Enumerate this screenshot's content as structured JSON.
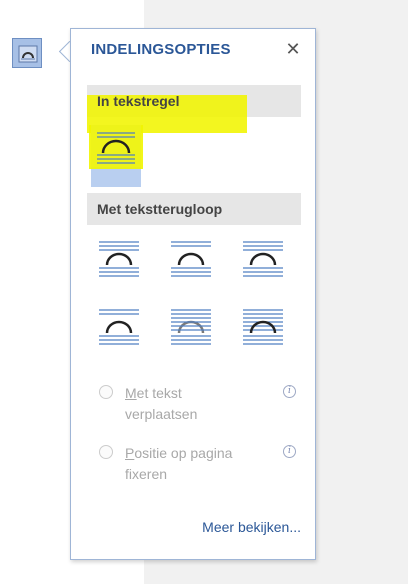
{
  "panel": {
    "title": "INDELINGSOPTIES",
    "close_glyph": "✕",
    "close_icon": "close-icon"
  },
  "sections": {
    "inline": {
      "label": "In tekstregel"
    },
    "wrap": {
      "label": "Met tekstterugloop"
    }
  },
  "options": {
    "inline": {
      "name": "in-line-with-text",
      "icon": "inline-layout-icon",
      "selected": true
    },
    "wrapping": [
      {
        "name": "square",
        "icon": "square-wrap-icon"
      },
      {
        "name": "tight",
        "icon": "tight-wrap-icon"
      },
      {
        "name": "through",
        "icon": "through-wrap-icon"
      },
      {
        "name": "top-and-bottom",
        "icon": "top-bottom-wrap-icon"
      },
      {
        "name": "behind-text",
        "icon": "behind-text-icon"
      },
      {
        "name": "in-front-of-text",
        "icon": "in-front-of-text-icon"
      }
    ]
  },
  "radios": {
    "move_with_text": {
      "accel": "M",
      "rest1": "et tekst",
      "line2": "verplaatsen",
      "info_icon": "info-icon"
    },
    "fix_position": {
      "accel": "P",
      "rest1": "ositie op pagina",
      "line2": "fixeren",
      "info_icon": "info-icon"
    }
  },
  "more_link": "Meer bekijken...",
  "colors": {
    "accent": "#2b5797",
    "highlight": "#f1f500",
    "selected_bg": "#cfe0f7",
    "section_bg": "#e6e6e6",
    "disabled_text": "#a8a8a8"
  },
  "anchor_button": {
    "icon": "layout-options-icon"
  }
}
